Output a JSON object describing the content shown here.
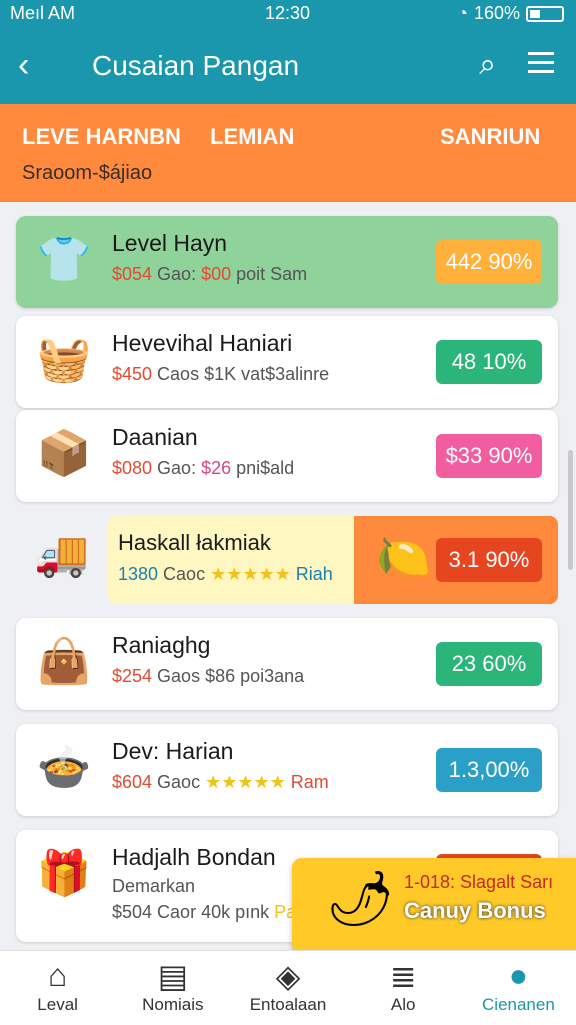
{
  "status": {
    "left": "Meıl AM",
    "time": "12:30",
    "battery": "160%"
  },
  "header": {
    "title": "Cusaian Pangan"
  },
  "banner": {
    "col1": "LEVE HARNBN",
    "col2": "LEMIAN",
    "col3": "SANRIUN",
    "subtitle": "Sraoom-$ájiao"
  },
  "cards": [
    {
      "name": "Level Hayn",
      "meta_a": "$054",
      "meta_b": " Gao: ",
      "meta_c": "$00",
      "meta_d": " poit Sam",
      "badge": "442 90%",
      "badge_color": "#ffb13b",
      "icon": "shirt-icon",
      "glyph": "👕"
    },
    {
      "name": "Hevevihal Haniari",
      "meta_a": "$450",
      "meta_b": " Caos $1K vat$3alinre",
      "meta_c": "",
      "meta_d": "",
      "badge": "48 10%",
      "badge_color": "#2bb57a",
      "icon": "basket-icon",
      "glyph": "🧺"
    },
    {
      "name": "Daanian",
      "meta_a": "$080",
      "meta_b": " Gao: ",
      "meta_c": "$26",
      "meta_d": " pni$ald",
      "badge": "$33 90%",
      "badge_color": "#f25da0",
      "icon": "food-box-icon",
      "glyph": "📦"
    },
    {
      "name": "Haskall łakmiak",
      "meta_a": "1380",
      "meta_b": " Caoc ",
      "meta_c": "★★★★★",
      "meta_d": " Riah",
      "badge": "3.1 90%",
      "badge_color": "#e5461f",
      "icon": "truck-icon",
      "glyph": "🚚"
    },
    {
      "name": "Raniaghg",
      "meta_a": "$254",
      "meta_b": " Gaos $86 poi3ana",
      "meta_c": "",
      "meta_d": "",
      "badge": "23 60%",
      "badge_color": "#2bb57a",
      "icon": "bag-icon",
      "glyph": "👜"
    },
    {
      "name": "Dev: Harian",
      "meta_a": "$604",
      "meta_b": " Gaoc ",
      "meta_c": "★★★★★",
      "meta_d": " Ram",
      "badge": "1.3,00%",
      "badge_color": "#2a9fc8",
      "icon": "bowl-icon",
      "glyph": "🍲"
    },
    {
      "name": "Hadjalh Bondan",
      "meta_a": "$504",
      "meta_b": " Caor 40k pınk ",
      "meta_c": "",
      "meta_d": "Pa",
      "badge": "",
      "badge_color": "#e5461f",
      "icon": "gift-box-icon",
      "glyph": "🎁",
      "sub": "Demarkan"
    }
  ],
  "bonus": {
    "title": "1-018: Slagalt Sarı",
    "label": "Canuy Bonus"
  },
  "nav": [
    {
      "label": "Leval",
      "icon": "home-icon",
      "glyph": "⌂"
    },
    {
      "label": "Nomiais",
      "icon": "chart-icon",
      "glyph": "▤"
    },
    {
      "label": "Entoalaan",
      "icon": "map-icon",
      "glyph": "◈"
    },
    {
      "label": "Alo",
      "icon": "list-icon",
      "glyph": "≣"
    },
    {
      "label": "Cienanen",
      "icon": "user-icon",
      "glyph": "●"
    }
  ]
}
